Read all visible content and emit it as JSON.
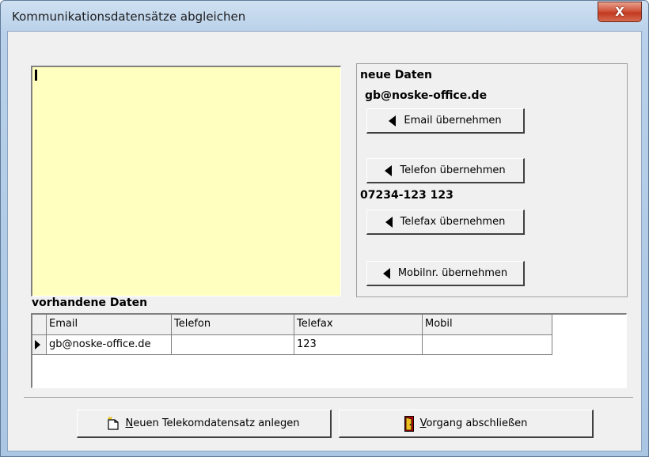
{
  "window": {
    "title": "Kommunikationsdatensätze abgleichen",
    "close_glyph": "X"
  },
  "new_data": {
    "title": "neue Daten",
    "email_value": "gb@noske-office.de",
    "phone_value": "07234-123 123",
    "buttons": {
      "email": "Email übernehmen",
      "phone": "Telefon übernehmen",
      "fax": "Telefax übernehmen",
      "mobile": "Mobilnr. übernehmen"
    }
  },
  "existing": {
    "label": "vorhandene Daten",
    "columns": [
      "Email",
      "Telefon",
      "Telefax",
      "Mobil"
    ],
    "rows": [
      {
        "email": "gb@noske-office.de",
        "phone": "",
        "fax": "123",
        "mobile": ""
      }
    ]
  },
  "actions": {
    "new_record": {
      "accel": "N",
      "rest": "euen Telekomdatensatz anlegen",
      "icon": "new-document-icon"
    },
    "finish": {
      "accel": "V",
      "rest": "organg abschließen",
      "icon": "exit-door-icon"
    }
  }
}
